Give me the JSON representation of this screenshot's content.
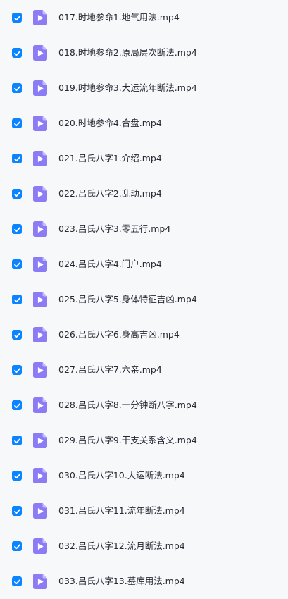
{
  "colors": {
    "checkbox": "#0a84ff",
    "video_icon": "#8b7cf6",
    "video_icon_fold": "#c4baff",
    "text": "#252933",
    "background": "#f7f8fa"
  },
  "file_list": {
    "items": [
      {
        "name": "017.时地参命1.地气用法.mp4",
        "checked": true,
        "icon": "video-file-icon"
      },
      {
        "name": "018.时地参命2.原局层次断法.mp4",
        "checked": true,
        "icon": "video-file-icon"
      },
      {
        "name": "019.时地参命3.大运流年断法.mp4",
        "checked": true,
        "icon": "video-file-icon"
      },
      {
        "name": "020.时地参命4.合盘.mp4",
        "checked": true,
        "icon": "video-file-icon"
      },
      {
        "name": "021.吕氏八字1.介绍.mp4",
        "checked": true,
        "icon": "video-file-icon"
      },
      {
        "name": "022.吕氏八字2.乱动.mp4",
        "checked": true,
        "icon": "video-file-icon"
      },
      {
        "name": "023.吕氏八字3.零五行.mp4",
        "checked": true,
        "icon": "video-file-icon"
      },
      {
        "name": "024.吕氏八字4.门户.mp4",
        "checked": true,
        "icon": "video-file-icon"
      },
      {
        "name": "025.吕氏八字5.身体特征吉凶.mp4",
        "checked": true,
        "icon": "video-file-icon"
      },
      {
        "name": "026.吕氏八字6.身高吉凶.mp4",
        "checked": true,
        "icon": "video-file-icon"
      },
      {
        "name": "027.吕氏八字7.六亲.mp4",
        "checked": true,
        "icon": "video-file-icon"
      },
      {
        "name": "028.吕氏八字8.一分钟断八字.mp4",
        "checked": true,
        "icon": "video-file-icon"
      },
      {
        "name": "029.吕氏八字9.干支关系含义.mp4",
        "checked": true,
        "icon": "video-file-icon"
      },
      {
        "name": "030.吕氏八字10.大运断法.mp4",
        "checked": true,
        "icon": "video-file-icon"
      },
      {
        "name": "031.吕氏八字11.流年断法.mp4",
        "checked": true,
        "icon": "video-file-icon"
      },
      {
        "name": "032.吕氏八字12.流月断法.mp4",
        "checked": true,
        "icon": "video-file-icon"
      },
      {
        "name": "033.吕氏八字13.墓库用法.mp4",
        "checked": true,
        "icon": "video-file-icon"
      }
    ]
  }
}
